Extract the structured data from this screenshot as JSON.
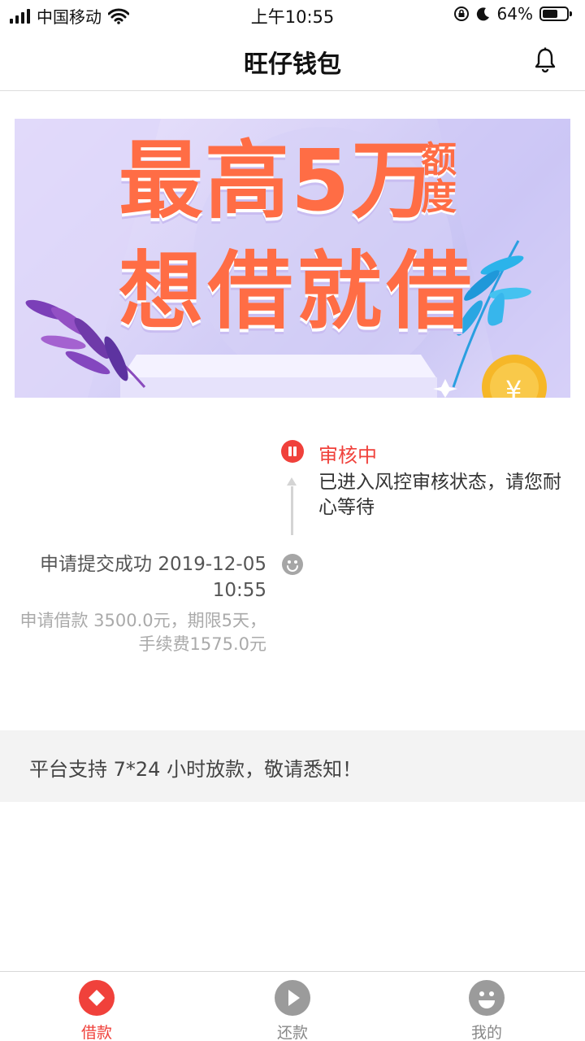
{
  "status_bar": {
    "carrier": "中国移动",
    "time": "上午10:55",
    "battery": "64%",
    "battery_level": 0.64,
    "icons": [
      "signal-icon",
      "wifi-icon",
      "rotation-lock-icon",
      "moon-icon",
      "battery-icon"
    ]
  },
  "header": {
    "title": "旺仔钱包",
    "icon": "bell-icon"
  },
  "banner": {
    "line1": "最高5万",
    "side": "额度",
    "line2": "想借就借"
  },
  "timeline": {
    "current": {
      "title": "审核中",
      "desc": "已进入风控审核状态，请您耐心等待",
      "icon": "pause-icon",
      "color": "#f0413b"
    },
    "submitted": {
      "title": "申请提交成功 2019-12-05 10:55",
      "detail": "申请借款 3500.0元，期限5天，手续费1575.0元",
      "icon": "smile-icon"
    }
  },
  "notice": {
    "text": "平台支持 7*24 小时放款，敬请悉知！"
  },
  "tabs": [
    {
      "label": "借款",
      "icon": "diamond-icon",
      "active": true
    },
    {
      "label": "还款",
      "icon": "play-icon",
      "active": false
    },
    {
      "label": "我的",
      "icon": "face-icon",
      "active": false
    }
  ],
  "colors": {
    "accent": "#f0413b",
    "banner_text": "#ff6d45"
  }
}
